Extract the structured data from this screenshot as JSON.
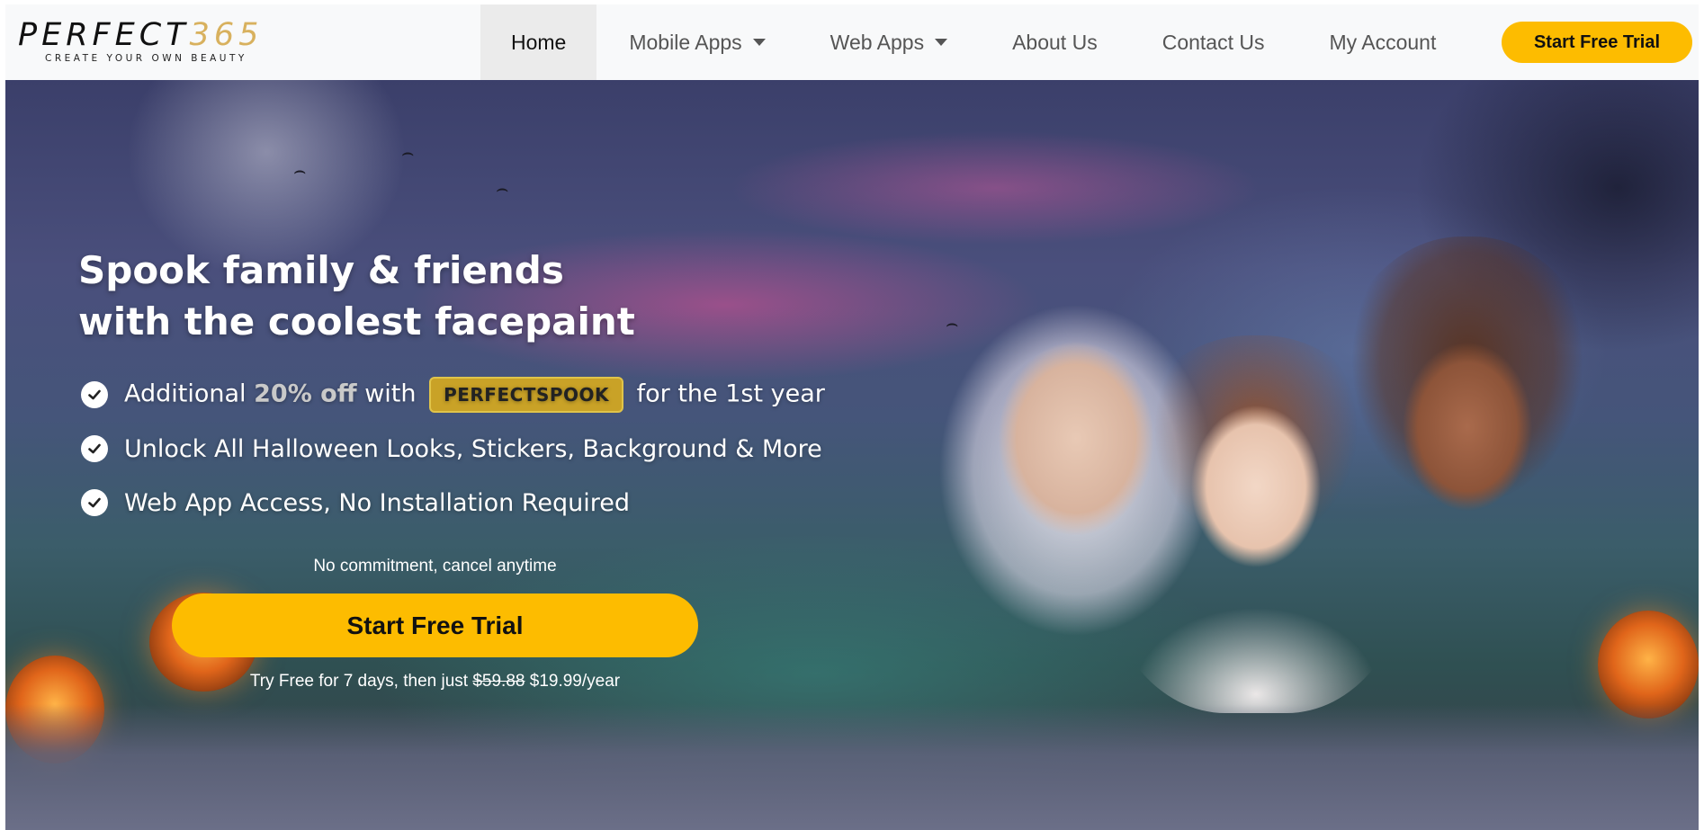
{
  "brand": {
    "name_letters": "PERFECT",
    "name_number": "365",
    "tagline": "CREATE YOUR OWN BEAUTY"
  },
  "nav": {
    "items": [
      {
        "label": "Home",
        "active": true,
        "dropdown": false
      },
      {
        "label": "Mobile Apps",
        "active": false,
        "dropdown": true
      },
      {
        "label": "Web Apps",
        "active": false,
        "dropdown": true
      },
      {
        "label": "About Us",
        "active": false,
        "dropdown": false
      },
      {
        "label": "Contact Us",
        "active": false,
        "dropdown": false
      },
      {
        "label": "My Account",
        "active": false,
        "dropdown": false
      }
    ],
    "cta_label": "Start Free Trial"
  },
  "hero": {
    "title_line1": "Spook family & friends",
    "title_line2": "with the coolest facepaint",
    "bullets": {
      "b1_prefix": "Additional",
      "b1_highlight": "20% off",
      "b1_with": "with",
      "b1_code": "PERFECTSPOOK",
      "b1_suffix": "for the 1st year",
      "b2": "Unlock All Halloween Looks, Stickers, Background & More",
      "b3": "Web App Access, No Installation Required"
    },
    "commitment": "No commitment, cancel anytime",
    "cta_label": "Start Free Trial",
    "price_prefix": "Try Free for 7 days, then just",
    "price_old": "$59.88",
    "price_new": "$19.99/year"
  },
  "colors": {
    "accent": "#fdbc00",
    "logo_number": "#d8b15e",
    "code_badge": "#c9a227"
  }
}
